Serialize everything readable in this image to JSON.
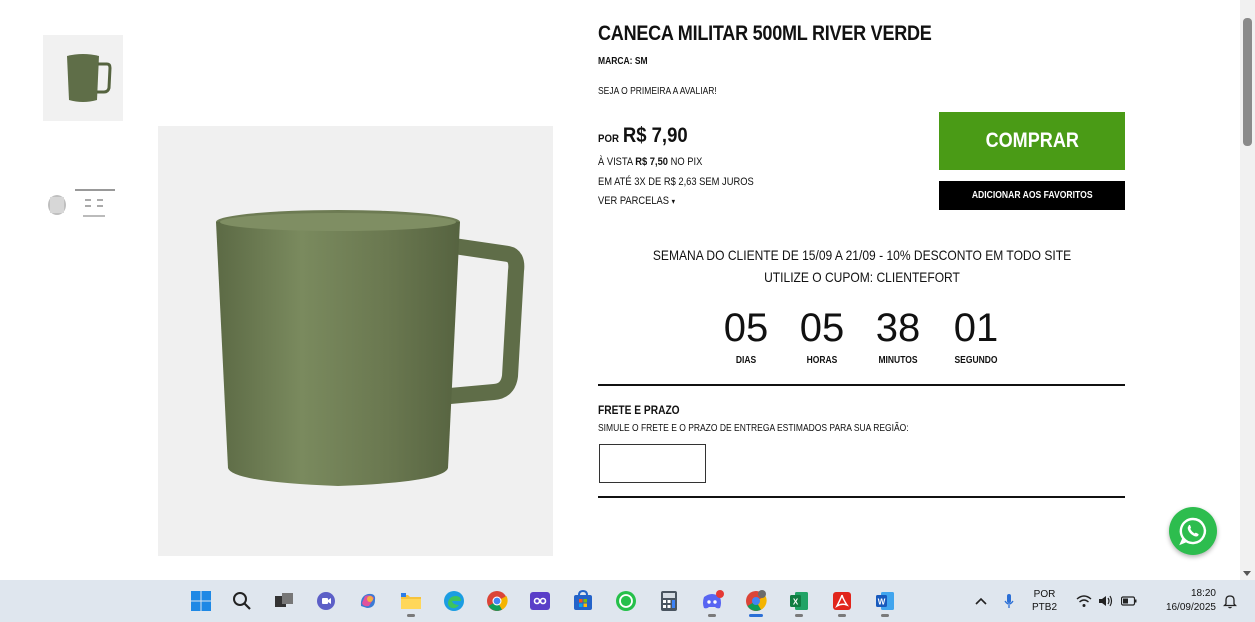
{
  "product": {
    "title": "CANECA MILITAR 500ML RIVER VERDE",
    "brand": "MARCA: SM",
    "review_prompt": "SEJA O PRIMEIRA A AVALIAR!",
    "color": "#6b7a52"
  },
  "price": {
    "prefix": "POR",
    "value": "R$ 7,90",
    "pix_prefix": "À VISTA",
    "pix_value": "R$ 7,50",
    "pix_suffix": "NO PIX",
    "installments": "EM ATÉ 3X DE R$ 2,63 SEM JUROS",
    "see_installments": "VER PARCELAS"
  },
  "actions": {
    "buy_label": "COMPRAR",
    "favorite_label": "ADICIONAR AOS FAVORITOS",
    "buy_color": "#4a9b16"
  },
  "promo": {
    "text": "SEMANA DO CLIENTE DE 15/09 A 21/09 - 10% DESCONTO EM TODO SITE UTILIZE O CUPOM: CLIENTEFORT"
  },
  "countdown": [
    {
      "value": "05",
      "label": "DIAS"
    },
    {
      "value": "05",
      "label": "HORAS"
    },
    {
      "value": "38",
      "label": "MINUTOS"
    },
    {
      "value": "01",
      "label": "SEGUNDO"
    }
  ],
  "shipping": {
    "title": "FRETE E PRAZO",
    "description": "SIMULE O FRETE E O PRAZO DE ENTREGA ESTIMADOS PARA SUA REGIÃO:",
    "cep_value": ""
  },
  "taskbar": {
    "icons": [
      "windows-start-icon",
      "search-icon",
      "task-view-icon",
      "teams-meet-icon",
      "copilot-icon",
      "file-explorer-icon",
      "edge-icon",
      "chrome-icon",
      "media-icon",
      "store-icon",
      "whatsapp-icon",
      "calculator-icon",
      "discord-icon",
      "chrome-profile-icon",
      "excel-icon",
      "acrobat-icon",
      "word-icon"
    ],
    "lang_line1": "POR",
    "lang_line2": "PTB2",
    "time": "18:20",
    "date": "16/09/2025"
  }
}
